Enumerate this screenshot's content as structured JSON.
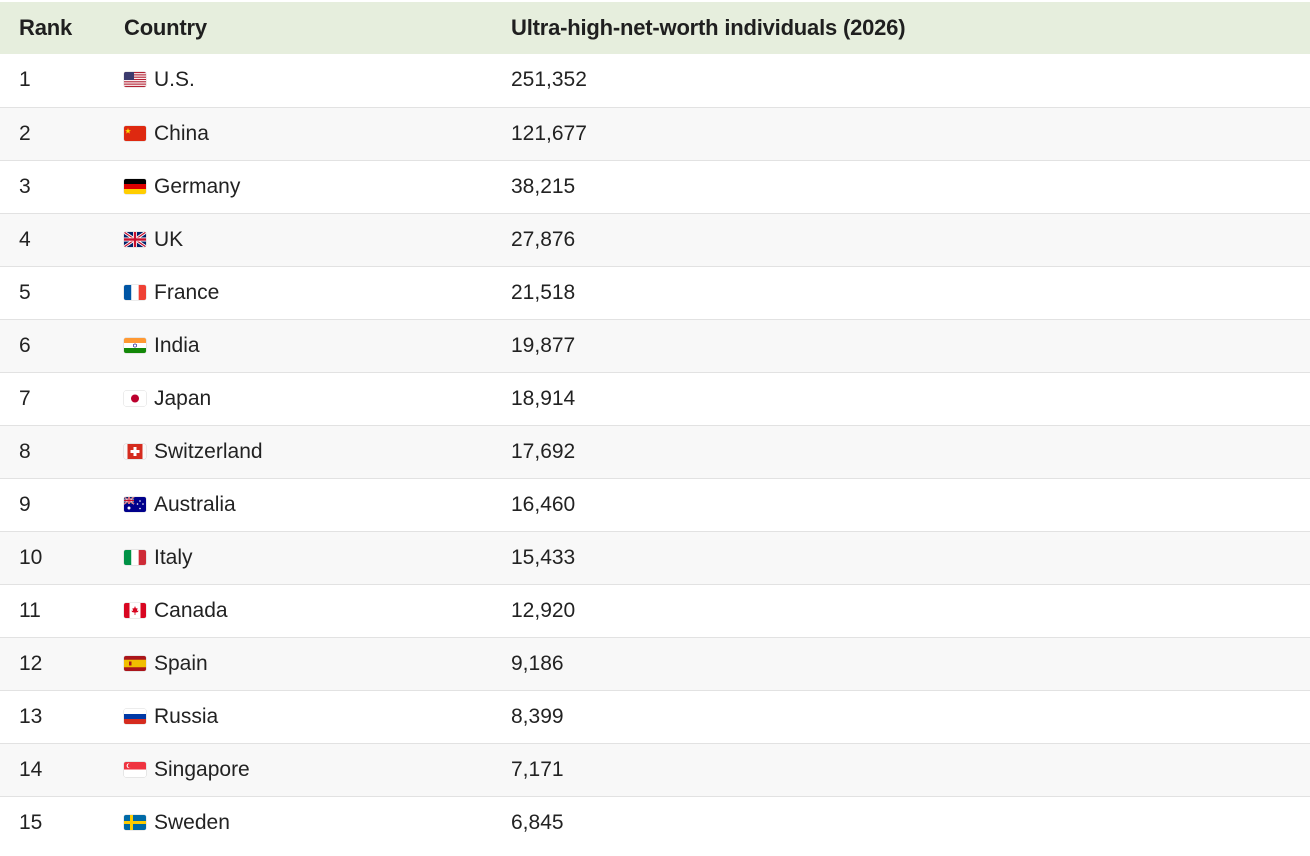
{
  "chart_data": {
    "type": "table",
    "columns": [
      "Rank",
      "Country",
      "Ultra-high-net-worth individuals (2026)"
    ],
    "rows": [
      {
        "rank": "1",
        "country": "U.S.",
        "flag": "us-flag-icon",
        "value": "251,352"
      },
      {
        "rank": "2",
        "country": "China",
        "flag": "china-flag-icon",
        "value": "121,677"
      },
      {
        "rank": "3",
        "country": "Germany",
        "flag": "germany-flag-icon",
        "value": "38,215"
      },
      {
        "rank": "4",
        "country": "UK",
        "flag": "uk-flag-icon",
        "value": "27,876"
      },
      {
        "rank": "5",
        "country": "France",
        "flag": "france-flag-icon",
        "value": "21,518"
      },
      {
        "rank": "6",
        "country": "India",
        "flag": "india-flag-icon",
        "value": "19,877"
      },
      {
        "rank": "7",
        "country": "Japan",
        "flag": "japan-flag-icon",
        "value": "18,914"
      },
      {
        "rank": "8",
        "country": "Switzerland",
        "flag": "switzerland-flag-icon",
        "value": "17,692"
      },
      {
        "rank": "9",
        "country": "Australia",
        "flag": "australia-flag-icon",
        "value": "16,460"
      },
      {
        "rank": "10",
        "country": "Italy",
        "flag": "italy-flag-icon",
        "value": "15,433"
      },
      {
        "rank": "11",
        "country": "Canada",
        "flag": "canada-flag-icon",
        "value": "12,920"
      },
      {
        "rank": "12",
        "country": "Spain",
        "flag": "spain-flag-icon",
        "value": "9,186"
      },
      {
        "rank": "13",
        "country": "Russia",
        "flag": "russia-flag-icon",
        "value": "8,399"
      },
      {
        "rank": "14",
        "country": "Singapore",
        "flag": "singapore-flag-icon",
        "value": "7,171"
      },
      {
        "rank": "15",
        "country": "Sweden",
        "flag": "sweden-flag-icon",
        "value": "6,845"
      }
    ]
  },
  "colors": {
    "header_bg": "#e6eedd",
    "row_alt_bg": "#f8f8f8",
    "row_bg": "#ffffff",
    "divider": "#e2e2e2",
    "text": "#1f1f1f"
  }
}
